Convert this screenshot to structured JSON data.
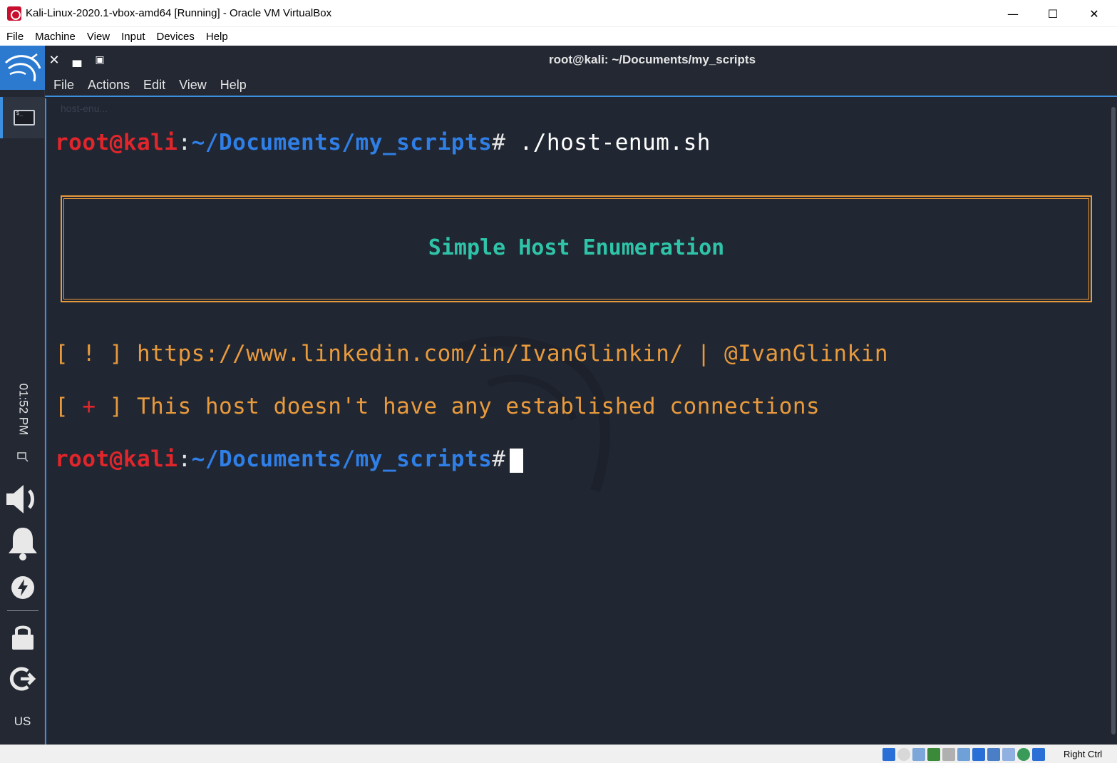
{
  "vbox": {
    "title": "Kali-Linux-2020.1-vbox-amd64 [Running] - Oracle VM VirtualBox",
    "menu": [
      "File",
      "Machine",
      "View",
      "Input",
      "Devices",
      "Help"
    ],
    "host_key": "Right Ctrl"
  },
  "panel": {
    "clock": "01:52 PM",
    "keyboard_layout": "US"
  },
  "terminal": {
    "title": "root@kali: ~/Documents/my_scripts",
    "menu": [
      "File",
      "Actions",
      "Edit",
      "View",
      "Help"
    ],
    "ghost_tab": "host-enu...",
    "prompt_user": "root@kali",
    "prompt_colon": ":",
    "prompt_path": "~/Documents/my_scripts",
    "prompt_hash": "#",
    "command": " ./host-enum.sh",
    "banner": "Simple Host Enumeration",
    "line1_prefix": "[ ! ] ",
    "line1_text": "https://www.linkedin.com/in/IvanGlinkin/ | @IvanGlinkin",
    "line2_open": "[ ",
    "line2_plus": "+",
    "line2_close": " ] ",
    "line2_text": "This host doesn't have any established connections"
  },
  "colors": {
    "terminal_bg": "#202632",
    "prompt_user": "#e0262b",
    "prompt_path": "#2f7fe6",
    "banner_text": "#2fc3a8",
    "output_orange": "#e89a3c",
    "accent_blue": "#3d8fe0"
  }
}
